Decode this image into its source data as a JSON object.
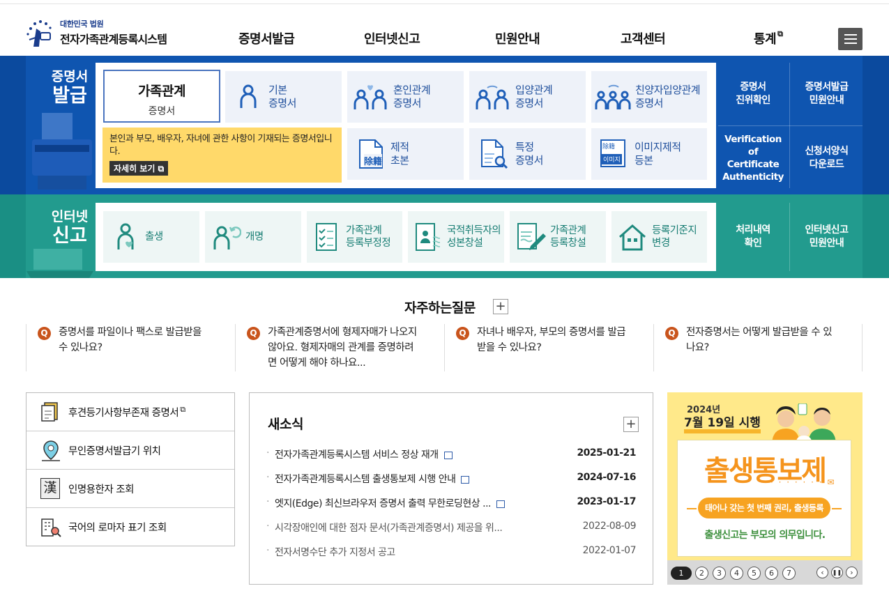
{
  "header": {
    "logo_small": "대한민국 법원",
    "logo_big": "전자가족관계등록시스템",
    "nav": [
      {
        "label": "증명서발급"
      },
      {
        "label": "인터넷신고"
      },
      {
        "label": "민원안내"
      },
      {
        "label": "고객센터"
      },
      {
        "label": "통계"
      }
    ]
  },
  "issue": {
    "side_t1": "증명서",
    "side_t2": "발급",
    "selected": {
      "l1": "가족관계",
      "l2": "증명서"
    },
    "desc": "본인과 부모, 배우자, 자녀에 관한 사항이 기재되는 증명서입니다.",
    "more": "자세히 보기",
    "tiles": [
      {
        "l1": "기본",
        "l2": "증명서"
      },
      {
        "l1": "혼인관계",
        "l2": "증명서"
      },
      {
        "l1": "입양관계",
        "l2": "증명서"
      },
      {
        "l1": "친양자입양관계",
        "l2": "증명서"
      },
      {
        "l1": "제적",
        "l2": "초본"
      },
      {
        "l1": "특정",
        "l2": "증명서"
      },
      {
        "l1": "이미지제적",
        "l2": "등본"
      }
    ],
    "right": [
      {
        "l1": "증명서",
        "l2": "진위확인"
      },
      {
        "l1": "증명서발급",
        "l2": "민원안내"
      },
      {
        "l1": "Verification of",
        "l2": "Certificate",
        "l3": "Authenticity"
      },
      {
        "l1": "신청서양식",
        "l2": "다운로드"
      }
    ]
  },
  "report": {
    "side_t1": "인터넷",
    "side_t2": "신고",
    "tiles": [
      {
        "l1": "출생",
        "l2": ""
      },
      {
        "l1": "개명",
        "l2": ""
      },
      {
        "l1": "가족관계",
        "l2": "등록부정정"
      },
      {
        "l1": "국적취득자의",
        "l2": "성본창설"
      },
      {
        "l1": "가족관계",
        "l2": "등록창설"
      },
      {
        "l1": "등록기준지",
        "l2": "변경"
      }
    ],
    "right": [
      {
        "l1": "처리내역",
        "l2": "확인"
      },
      {
        "l1": "인터넷신고",
        "l2": "민원안내"
      }
    ]
  },
  "faq": {
    "title": "자주하는질문",
    "q_mark": "Q",
    "items": [
      {
        "l1": "증명서를 파일이나 팩스로 발급받을",
        "l2": "수 있나요?",
        "l3": ""
      },
      {
        "l1": "가족관계증명서에 형제자매가 나오지",
        "l2": "않아요. 형제자매의 관계를 증명하려",
        "l3": "면 어떻게 해야 하나요..."
      },
      {
        "l1": "자녀나 배우자, 부모의 증명서를 발급",
        "l2": "받을 수 있나요?",
        "l3": ""
      },
      {
        "l1": "전자증명서는 어떻게 발급받을 수 있",
        "l2": "나요?",
        "l3": ""
      }
    ]
  },
  "quick": [
    {
      "label": "후견등기사항부존재 증명서"
    },
    {
      "label": "무인증명서발급기 위치"
    },
    {
      "label": "인명용한자 조회"
    },
    {
      "label": "국어의 로마자 표기 조회"
    }
  ],
  "news": {
    "title": "새소식",
    "items": [
      {
        "title": "전자가족관계등록시스템 서비스 정상 재개",
        "date": "2025-01-21"
      },
      {
        "title": "전자가족관계등록시스템 출생통보제 시행 안내",
        "date": "2024-07-16"
      },
      {
        "title": "엣지(Edge) 최신브라우저 증명서 출력 무한로딩현상 ...",
        "date": "2023-01-17"
      },
      {
        "title": "시각장애인에 대한 점자 문서(가족관계증명서) 제공을 위...",
        "date": "2022-08-09"
      },
      {
        "title": "전자서명수단 추가 지정서 공고",
        "date": "2022-01-07"
      }
    ]
  },
  "banner": {
    "year": "2024년",
    "date": "7월 19일 시행",
    "main": "출생통보제",
    "pill": "태어나 갖는 첫 번째 권리, 출생등록",
    "bottom": "출생신고는 부모의 의무입니다.",
    "pages": [
      "1",
      "2",
      "3",
      "4",
      "5",
      "6",
      "7"
    ]
  },
  "icon_kanji": "漢",
  "tile_icon_text": {
    "jejeok": "除籍",
    "image": "이미지",
    "image_top": "除籍"
  }
}
